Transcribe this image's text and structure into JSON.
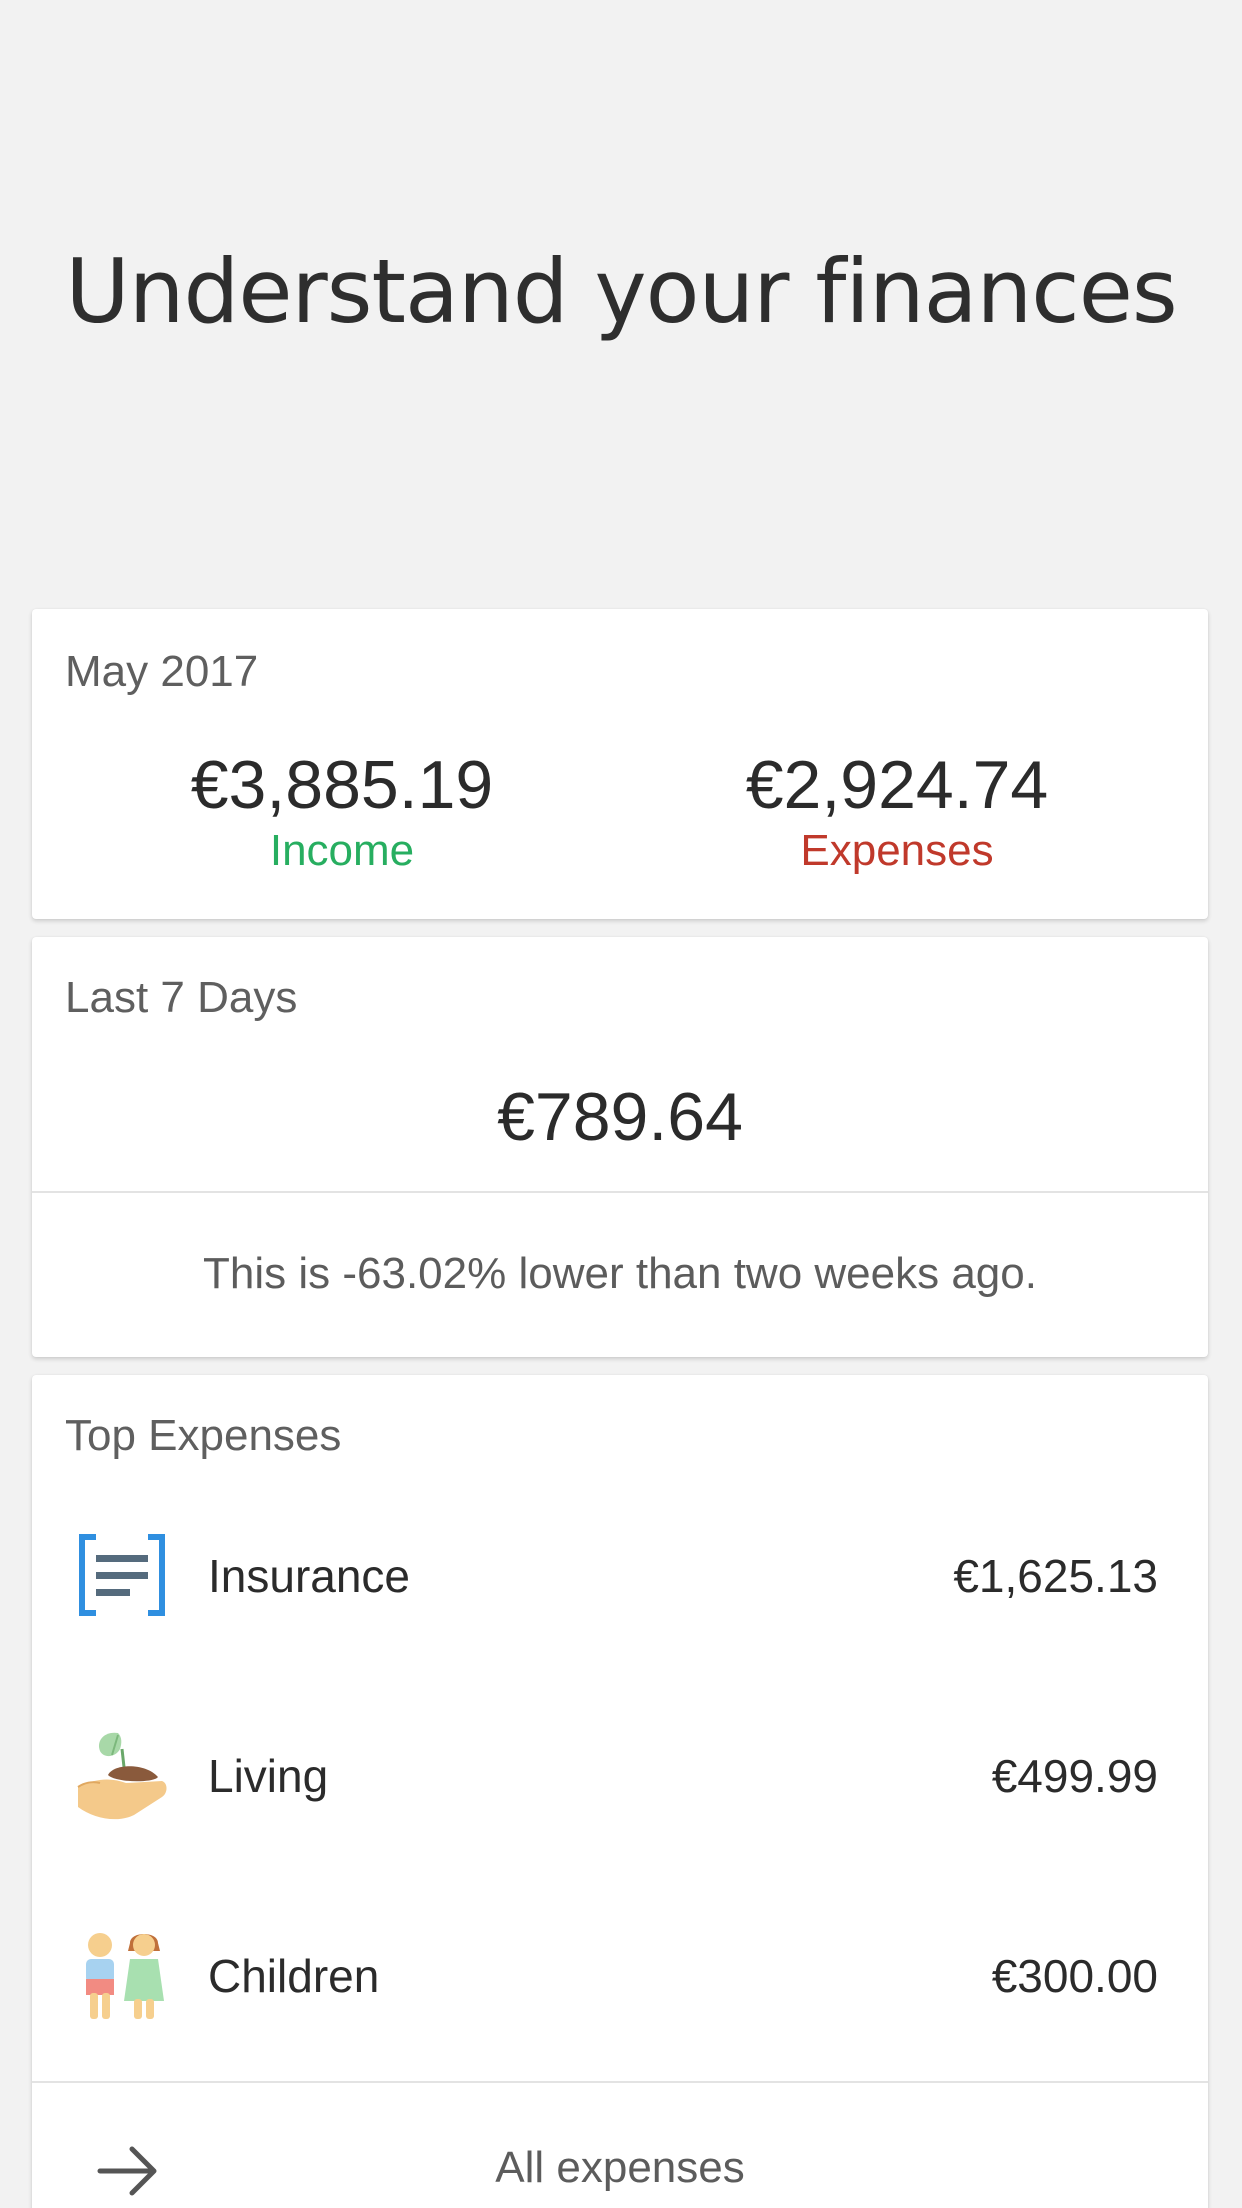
{
  "headline": "Understand your finances",
  "month_card": {
    "title": "May 2017",
    "income_amount": "€3,885.19",
    "income_label": "Income",
    "expenses_amount": "€2,924.74",
    "expenses_label": "Expenses",
    "income_color": "#27ae60",
    "expenses_color": "#c0392b"
  },
  "week_card": {
    "title": "Last 7 Days",
    "amount": "€789.64",
    "note": "This is -63.02% lower than two weeks ago."
  },
  "top_expenses": {
    "title": "Top Expenses",
    "items": [
      {
        "name": "Insurance",
        "value": "€1,625.13",
        "icon": "insurance-icon"
      },
      {
        "name": "Living",
        "value": "€499.99",
        "icon": "living-icon"
      },
      {
        "name": "Children",
        "value": "€300.00",
        "icon": "children-icon"
      }
    ],
    "all_label": "All expenses"
  }
}
